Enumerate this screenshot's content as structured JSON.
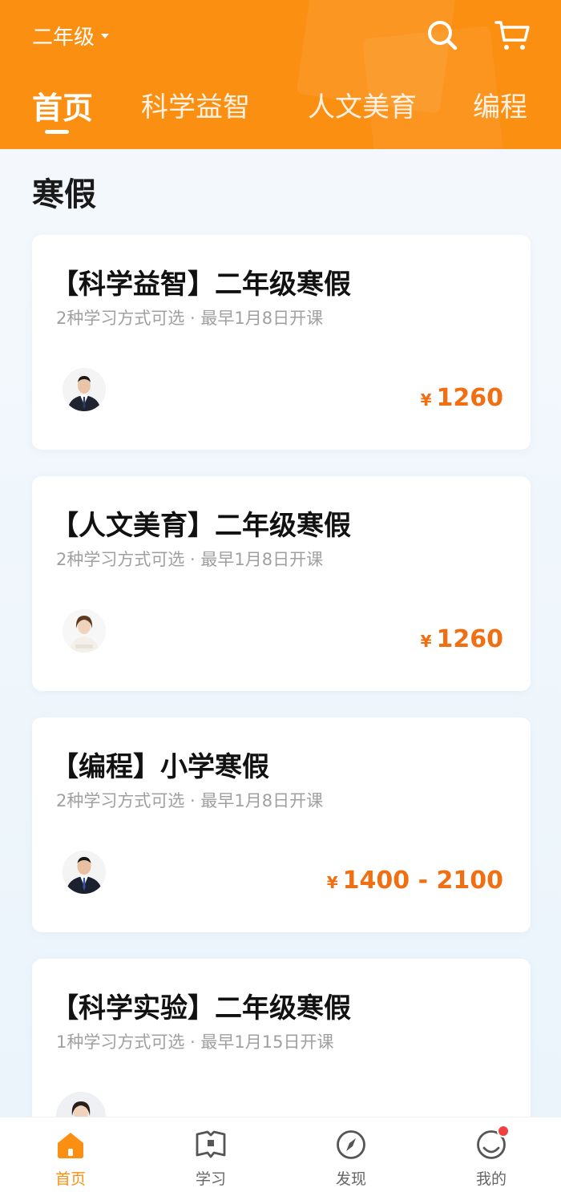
{
  "header": {
    "grade": "二年级",
    "tabs": [
      {
        "label": "首页",
        "active": true
      },
      {
        "label": "科学益智",
        "active": false
      },
      {
        "label": "人文美育",
        "active": false
      },
      {
        "label": "编程",
        "active": false
      }
    ]
  },
  "section": {
    "title": "寒假"
  },
  "courses": [
    {
      "title": "【科学益智】二年级寒假",
      "subtitle": "2种学习方式可选 · 最早1月8日开课",
      "currency": "¥",
      "price": "1260"
    },
    {
      "title": "【人文美育】二年级寒假",
      "subtitle": "2种学习方式可选 · 最早1月8日开课",
      "currency": "¥",
      "price": "1260"
    },
    {
      "title": "【编程】小学寒假",
      "subtitle": "2种学习方式可选 · 最早1月8日开课",
      "currency": "¥",
      "price": "1400 - 2100"
    },
    {
      "title": "【科学实验】二年级寒假",
      "subtitle": "1种学习方式可选 · 最早1月15日开课",
      "currency": "",
      "price": ""
    }
  ],
  "bottom_nav": [
    {
      "label": "首页",
      "icon": "home-icon",
      "active": true
    },
    {
      "label": "学习",
      "icon": "book-icon",
      "active": false
    },
    {
      "label": "发现",
      "icon": "compass-icon",
      "active": false
    },
    {
      "label": "我的",
      "icon": "profile-icon",
      "active": false,
      "badge": true
    }
  ],
  "colors": {
    "accent": "#fb8f12",
    "price": "#ef6f12",
    "badge": "#f04142"
  }
}
